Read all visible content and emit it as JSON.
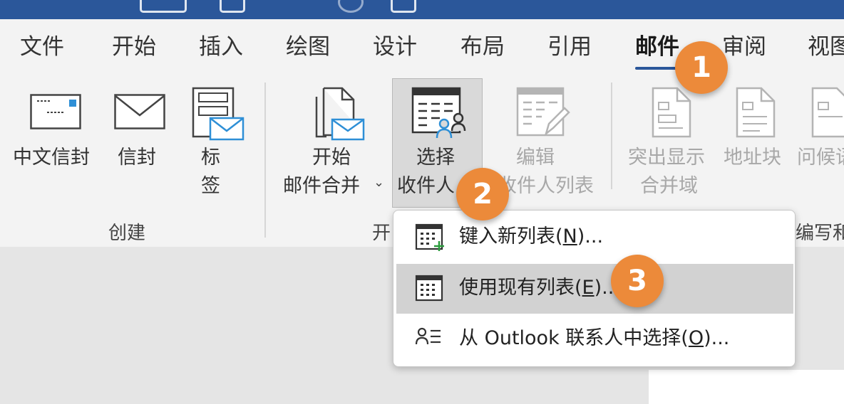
{
  "tabs": [
    {
      "label": "文件"
    },
    {
      "label": "开始"
    },
    {
      "label": "插入"
    },
    {
      "label": "绘图"
    },
    {
      "label": "设计"
    },
    {
      "label": "布局"
    },
    {
      "label": "引用"
    },
    {
      "label": "邮件",
      "active": true
    },
    {
      "label": "审阅"
    },
    {
      "label": "视图"
    }
  ],
  "ribbon": {
    "create": {
      "group_label": "创建",
      "envelopes_cn": "中文信封",
      "envelopes": "信封",
      "labels_line1": "标",
      "labels_line2": "签"
    },
    "start_merge": {
      "group_label_partial": "开",
      "start_line1": "开始",
      "start_line2": "邮件合并",
      "select_line1": "选择",
      "select_line2": "收件人",
      "edit_line1": "编辑",
      "edit_line2": "收件人列表"
    },
    "write_insert": {
      "group_label_partial": "编写和",
      "highlight_line1": "突出显示",
      "highlight_line2": "合并域",
      "address_block": "地址块",
      "greeting_line": "问候语"
    }
  },
  "dropdown": {
    "items": [
      {
        "text_pre": "键入新列表(",
        "accel": "N",
        "text_post": ")...",
        "icon": "new-list-icon"
      },
      {
        "text_pre": "使用现有列表(",
        "accel": "E",
        "text_post": ")...",
        "icon": "existing-list-icon",
        "highlighted": true
      },
      {
        "text_pre": "从 Outlook 联系人中选择(",
        "accel": "O",
        "text_post": ")...",
        "icon": "outlook-contacts-icon"
      }
    ]
  },
  "badges": [
    "1",
    "2",
    "3"
  ],
  "colors": {
    "title_bar": "#2b579a",
    "badge": "#ec8a3a",
    "ribbon_bg": "#f3f3f3",
    "icon_blue": "#2e8fd6"
  }
}
